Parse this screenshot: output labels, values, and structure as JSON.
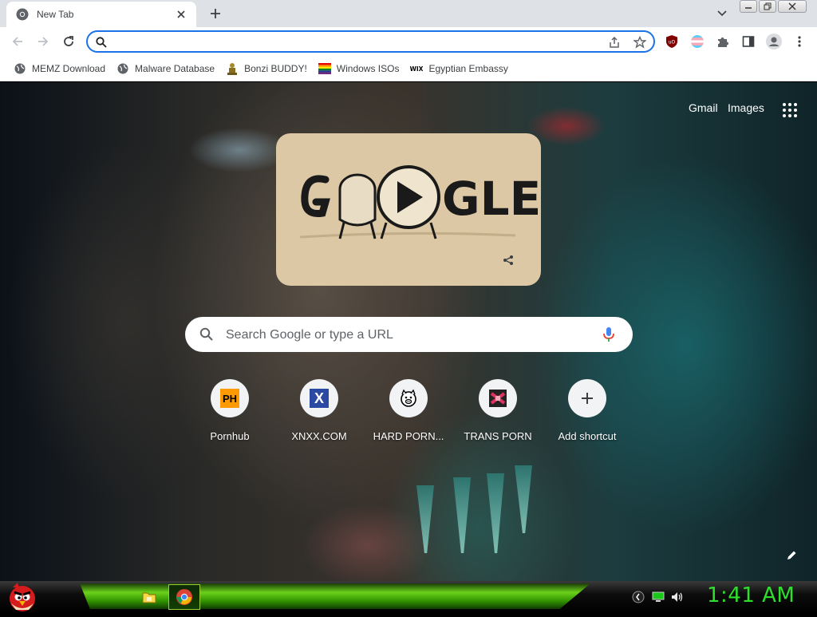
{
  "browser": {
    "tab": {
      "title": "New Tab",
      "favicon": "chrome-icon",
      "close_icon": "close-icon"
    },
    "new_tab_icon": "plus-icon",
    "tab_search_icon": "chevron-down-icon",
    "window_controls": [
      "minimize-icon",
      "restore-icon",
      "close-icon"
    ],
    "toolbar": {
      "back_icon": "arrow-left-icon",
      "forward_icon": "arrow-right-icon",
      "reload_icon": "reload-icon",
      "omnibox": {
        "value": "",
        "placeholder": ""
      },
      "omnibox_icons": [
        "search-icon",
        "share-icon",
        "star-icon"
      ],
      "extensions": [
        "ublock-origin-icon",
        "trans-flag-extension-icon",
        "puzzle-icon",
        "side-panel-icon",
        "profile-avatar-icon",
        "kebab-menu-icon"
      ]
    },
    "bookmarks": [
      {
        "label": "MEMZ Download",
        "icon": "globe-icon"
      },
      {
        "label": "Malware Database",
        "icon": "globe-icon"
      },
      {
        "label": "Bonzi BUDDY!",
        "icon": "bonzi-icon"
      },
      {
        "label": "Windows ISOs",
        "icon": "rainbow-flag-icon"
      },
      {
        "label": "Egyptian Embassy",
        "icon": "wix-icon"
      }
    ]
  },
  "page": {
    "top_links": {
      "gmail": "Gmail",
      "images": "Images"
    },
    "apps_icon": "apps-grid-icon",
    "doodle": {
      "text": "GOOGLE",
      "colors": {
        "card": "#dcc8a4",
        "ink": "#1a1a1a"
      },
      "play_icon": "play-icon",
      "share_icon": "share-icon"
    },
    "search": {
      "placeholder": "Search Google or type a URL",
      "search_icon": "search-icon",
      "mic_icon": "mic-icon"
    },
    "shortcuts": [
      {
        "label": "Pornhub",
        "icon_text": "PH",
        "colors": {
          "bg": "#ff9900",
          "fg": "#000000"
        }
      },
      {
        "label": "XNXX.COM",
        "icon_text": "X",
        "colors": {
          "bg": "#2a4aa3",
          "fg": "#ffffff"
        }
      },
      {
        "label": "HARD PORN...",
        "icon_text": "",
        "icon": "pig-face-icon"
      },
      {
        "label": "TRANS PORN",
        "icon_text": "",
        "icon": "trans-porn-favicon-icon"
      },
      {
        "label": "Add shortcut",
        "icon_text": "+",
        "icon": "plus-icon"
      }
    ],
    "customize_icon": "pencil-icon"
  },
  "taskbar": {
    "start_icon": "angry-bird-icon",
    "quick_launch_icon": "folder-icon",
    "task_icon": "chrome-icon",
    "tray_icons": [
      "keyboard-layout-icon",
      "network-monitor-icon",
      "speaker-icon"
    ],
    "clock": "1:41 AM",
    "colors": {
      "clock": "#2ce02c",
      "bar": "#4cb010"
    }
  }
}
